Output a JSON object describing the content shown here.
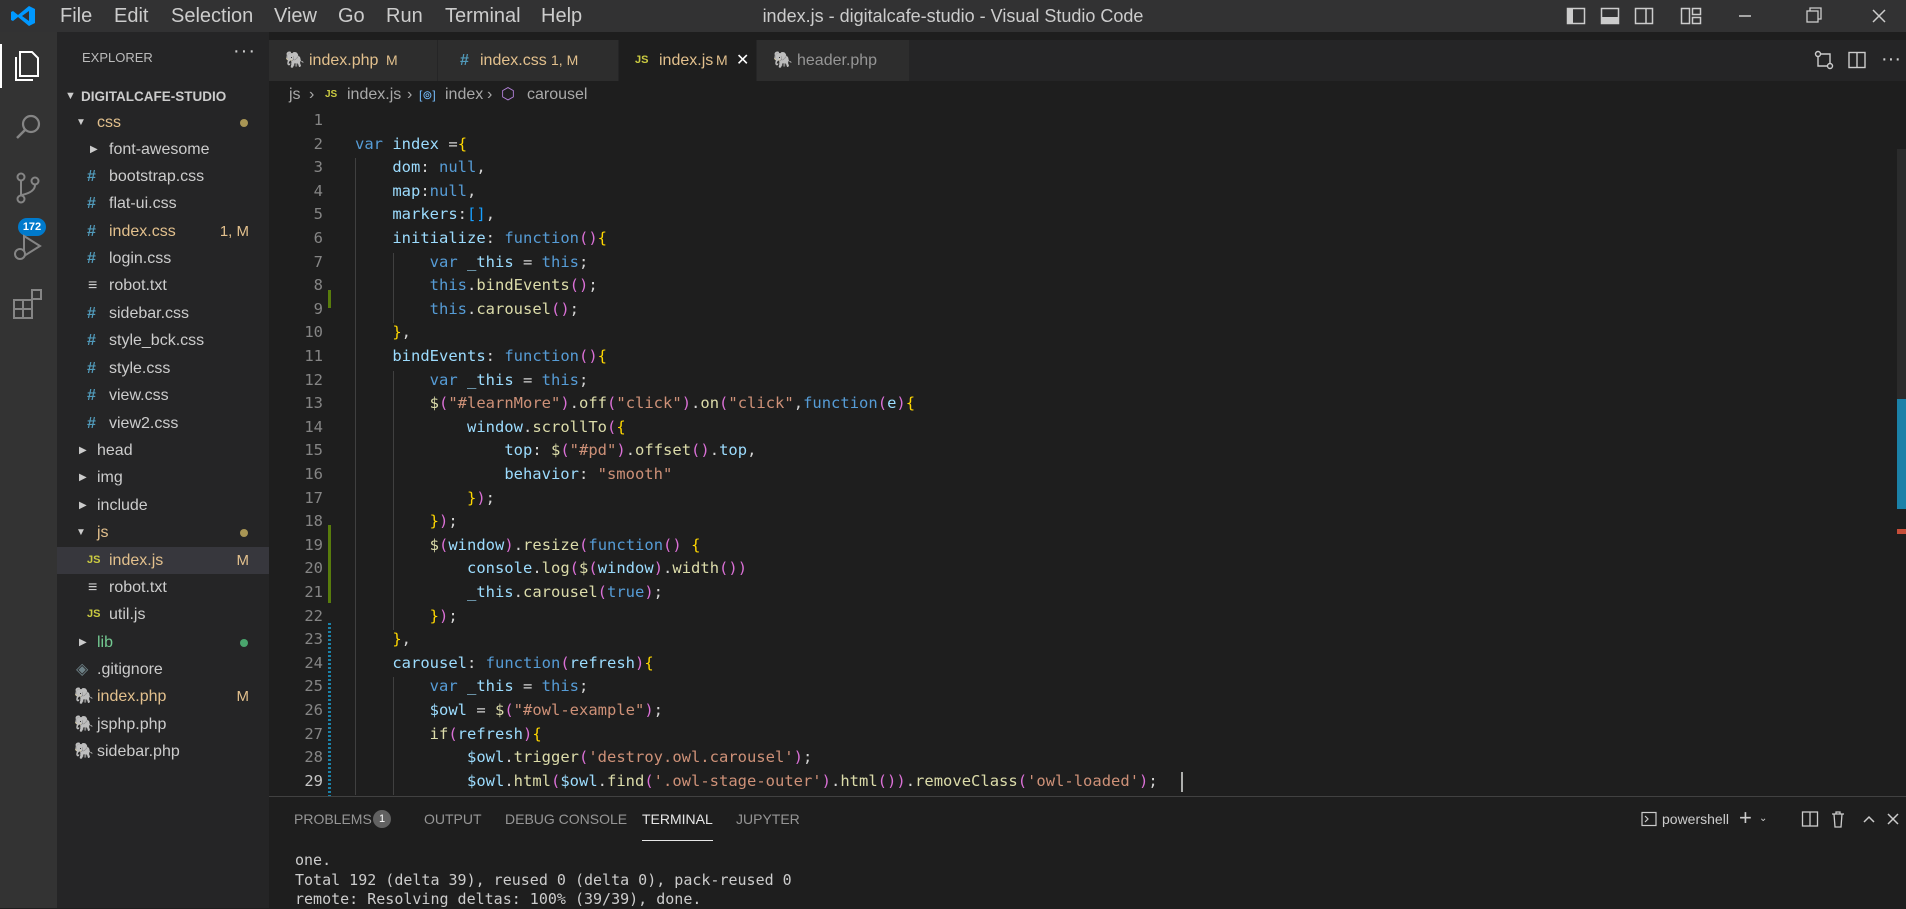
{
  "window": {
    "title": "index.js - digitalcafe-studio - Visual Studio Code",
    "menu": [
      "File",
      "Edit",
      "Selection",
      "View",
      "Go",
      "Run",
      "Terminal",
      "Help"
    ]
  },
  "activity": {
    "scm_badge": "172"
  },
  "sidebar": {
    "header": "EXPLORER",
    "project": "DIGITALCAFE-STUDIO",
    "tree": [
      {
        "label": "css",
        "badge": ""
      },
      {
        "label": "font-awesome",
        "badge": ""
      },
      {
        "label": "bootstrap.css",
        "badge": ""
      },
      {
        "label": "flat-ui.css",
        "badge": ""
      },
      {
        "label": "index.css",
        "badge": "1, M"
      },
      {
        "label": "login.css",
        "badge": ""
      },
      {
        "label": "robot.txt",
        "badge": ""
      },
      {
        "label": "sidebar.css",
        "badge": ""
      },
      {
        "label": "style_bck.css",
        "badge": ""
      },
      {
        "label": "style.css",
        "badge": ""
      },
      {
        "label": "view.css",
        "badge": ""
      },
      {
        "label": "view2.css",
        "badge": ""
      },
      {
        "label": "head",
        "badge": ""
      },
      {
        "label": "img",
        "badge": ""
      },
      {
        "label": "include",
        "badge": ""
      },
      {
        "label": "js",
        "badge": ""
      },
      {
        "label": "index.js",
        "badge": "M"
      },
      {
        "label": "robot.txt",
        "badge": ""
      },
      {
        "label": "util.js",
        "badge": ""
      },
      {
        "label": "lib",
        "badge": ""
      },
      {
        "label": ".gitignore",
        "badge": ""
      },
      {
        "label": "index.php",
        "badge": "M"
      },
      {
        "label": "jsphp.php",
        "badge": ""
      },
      {
        "label": "sidebar.php",
        "badge": ""
      }
    ],
    "colors": {
      "modified": "#e2c08d",
      "untracked": "#73c991",
      "selected_bg": "#37373d"
    }
  },
  "tabs": [
    {
      "label": "index.php",
      "status": "M"
    },
    {
      "label": "index.css",
      "status": "1, M"
    },
    {
      "label": "index.js",
      "status": "M"
    },
    {
      "label": "header.php",
      "status": ""
    }
  ],
  "breadcrumb": [
    "js",
    "index.js",
    "index",
    "carousel"
  ],
  "editor": {
    "line_numbers": [
      "1",
      "2",
      "3",
      "4",
      "5",
      "6",
      "7",
      "8",
      "9",
      "10",
      "11",
      "12",
      "13",
      "14",
      "15",
      "16",
      "17",
      "18",
      "19",
      "20",
      "21",
      "22",
      "23",
      "24",
      "25",
      "26",
      "27",
      "28",
      "29"
    ],
    "lines": [
      "",
      "var index ={",
      "    dom: null,",
      "    map:null,",
      "    markers:[],",
      "    initialize: function(){",
      "        var _this = this;",
      "        this.bindEvents();",
      "        this.carousel();",
      "    },",
      "    bindEvents: function(){",
      "        var _this = this;",
      "        $(\"#learnMore\").off(\"click\").on(\"click\",function(e){",
      "            window.scrollTo({",
      "                top: $(\"#pd\").offset().top,",
      "                behavior: \"smooth\"",
      "            });",
      "        });",
      "        $(window).resize(function() {",
      "            console.log($(window).width())",
      "            _this.carousel(true);",
      "        });",
      "    },",
      "    carousel: function(refresh){",
      "        var _this = this;",
      "        $owl = $(\"#owl-example\");",
      "        if(refresh){",
      "            $owl.trigger('destroy.owl.carousel');",
      "            $owl.html($owl.find('.owl-stage-outer').html()).removeClass('owl-loaded');"
    ]
  },
  "panel": {
    "tabs": [
      "PROBLEMS",
      "OUTPUT",
      "DEBUG CONSOLE",
      "TERMINAL",
      "JUPYTER"
    ],
    "problems_count": "1",
    "shell": "powershell",
    "terminal_lines": [
      "one.",
      "Total 192 (delta 39), reused 0 (delta 0), pack-reused 0",
      "remote: Resolving deltas: 100% (39/39), done."
    ]
  }
}
